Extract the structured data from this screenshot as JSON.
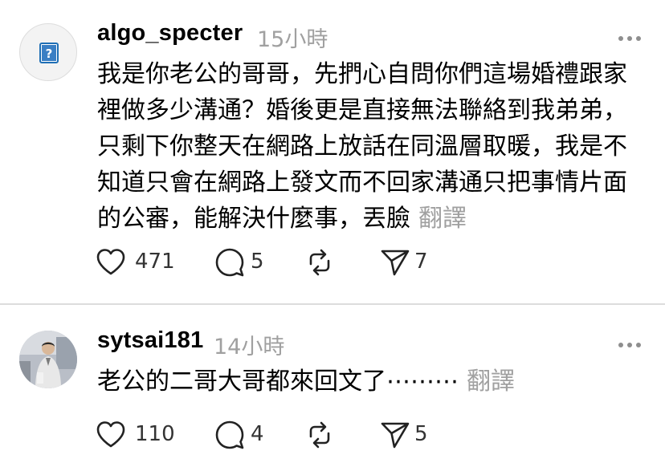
{
  "posts": [
    {
      "username": "algo_specter",
      "time": "15小時",
      "avatar_icon": "question-mark-icon",
      "lines": [
        "我是你老公的哥哥，先捫心自問你們這場婚禮跟家",
        "裡做多少溝通？婚後更是直接無法聯絡到我弟弟，",
        "只剩下你整天在網路上放話在同溫層取暖，我是不",
        "知道只會在網路上發文而不回家溝通只把事情片面",
        "的公審，能解決什麼事，丟臉"
      ],
      "translate_label": "翻譯",
      "likes": "471",
      "replies": "5",
      "reposts": "",
      "shares": "7"
    },
    {
      "username": "sytsai181",
      "time": "14小時",
      "avatar_icon": "profile-photo",
      "lines": [
        "老公的二哥大哥都來回文了⋯⋯⋯"
      ],
      "translate_label": "翻譯",
      "likes": "110",
      "replies": "4",
      "reposts": "",
      "shares": "5"
    }
  ],
  "colors": {
    "text": "#000000",
    "muted": "#a0a0a0",
    "divider": "#dcdcdc",
    "avatar_badge": "#1f6fb5"
  },
  "icons": [
    "heart-icon",
    "comment-icon",
    "repost-icon",
    "share-icon",
    "more-icon"
  ]
}
